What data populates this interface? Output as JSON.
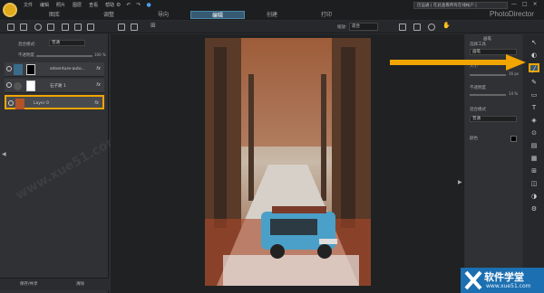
{
  "app": {
    "brand": "PhotoDirector"
  },
  "menu": [
    "文件",
    "编辑",
    "照片",
    "图层",
    "查看",
    "帮助"
  ],
  "modes": [
    {
      "label": "图库",
      "active": false
    },
    {
      "label": "调整",
      "active": false
    },
    {
      "label": "导向",
      "active": false
    },
    {
      "label": "编辑",
      "active": true
    },
    {
      "label": "创建",
      "active": false
    },
    {
      "label": "打印",
      "active": false
    }
  ],
  "notice": "历运通 | 在此查看所有在线帐户 |",
  "window_controls": [
    "—",
    "□",
    "×"
  ],
  "toolbar": {
    "zoom_label": "缩放:",
    "zoom_value": "适合"
  },
  "layers_panel": {
    "blend_label": "混合模式:",
    "blend_value": "普通",
    "opacity_label": "不透明度",
    "opacity_value": "100 %",
    "layers": [
      {
        "name": "adventure-auto...",
        "fx": "fx",
        "selected": false
      },
      {
        "name": "石子路 1",
        "fx": "fx",
        "selected": false
      },
      {
        "name": "Layer 0",
        "fx": "fx",
        "selected": true
      }
    ],
    "save_btn": "保存/共享",
    "clear_btn": "清除"
  },
  "right_panel": {
    "title": "画笔",
    "tool_label": "选择工具",
    "tool_value": "画笔",
    "size_label": "大小",
    "size_value": "16 px",
    "opacity_label": "不透明度",
    "opacity_value": "14 %",
    "blend_label": "混合模式",
    "blend_value": "普通",
    "color_label": "颜色"
  },
  "tools": [
    "↖",
    "◐",
    "╱",
    "✎",
    "▭",
    "T",
    "◈",
    "⊙",
    "▤",
    "▦",
    "⊞",
    "◫",
    "◑",
    "⚙"
  ],
  "corner": {
    "title": "软件学堂",
    "url": "www.xue51.com"
  },
  "colors": {
    "accent": "#f0a500",
    "active_mode": "#355a72"
  }
}
